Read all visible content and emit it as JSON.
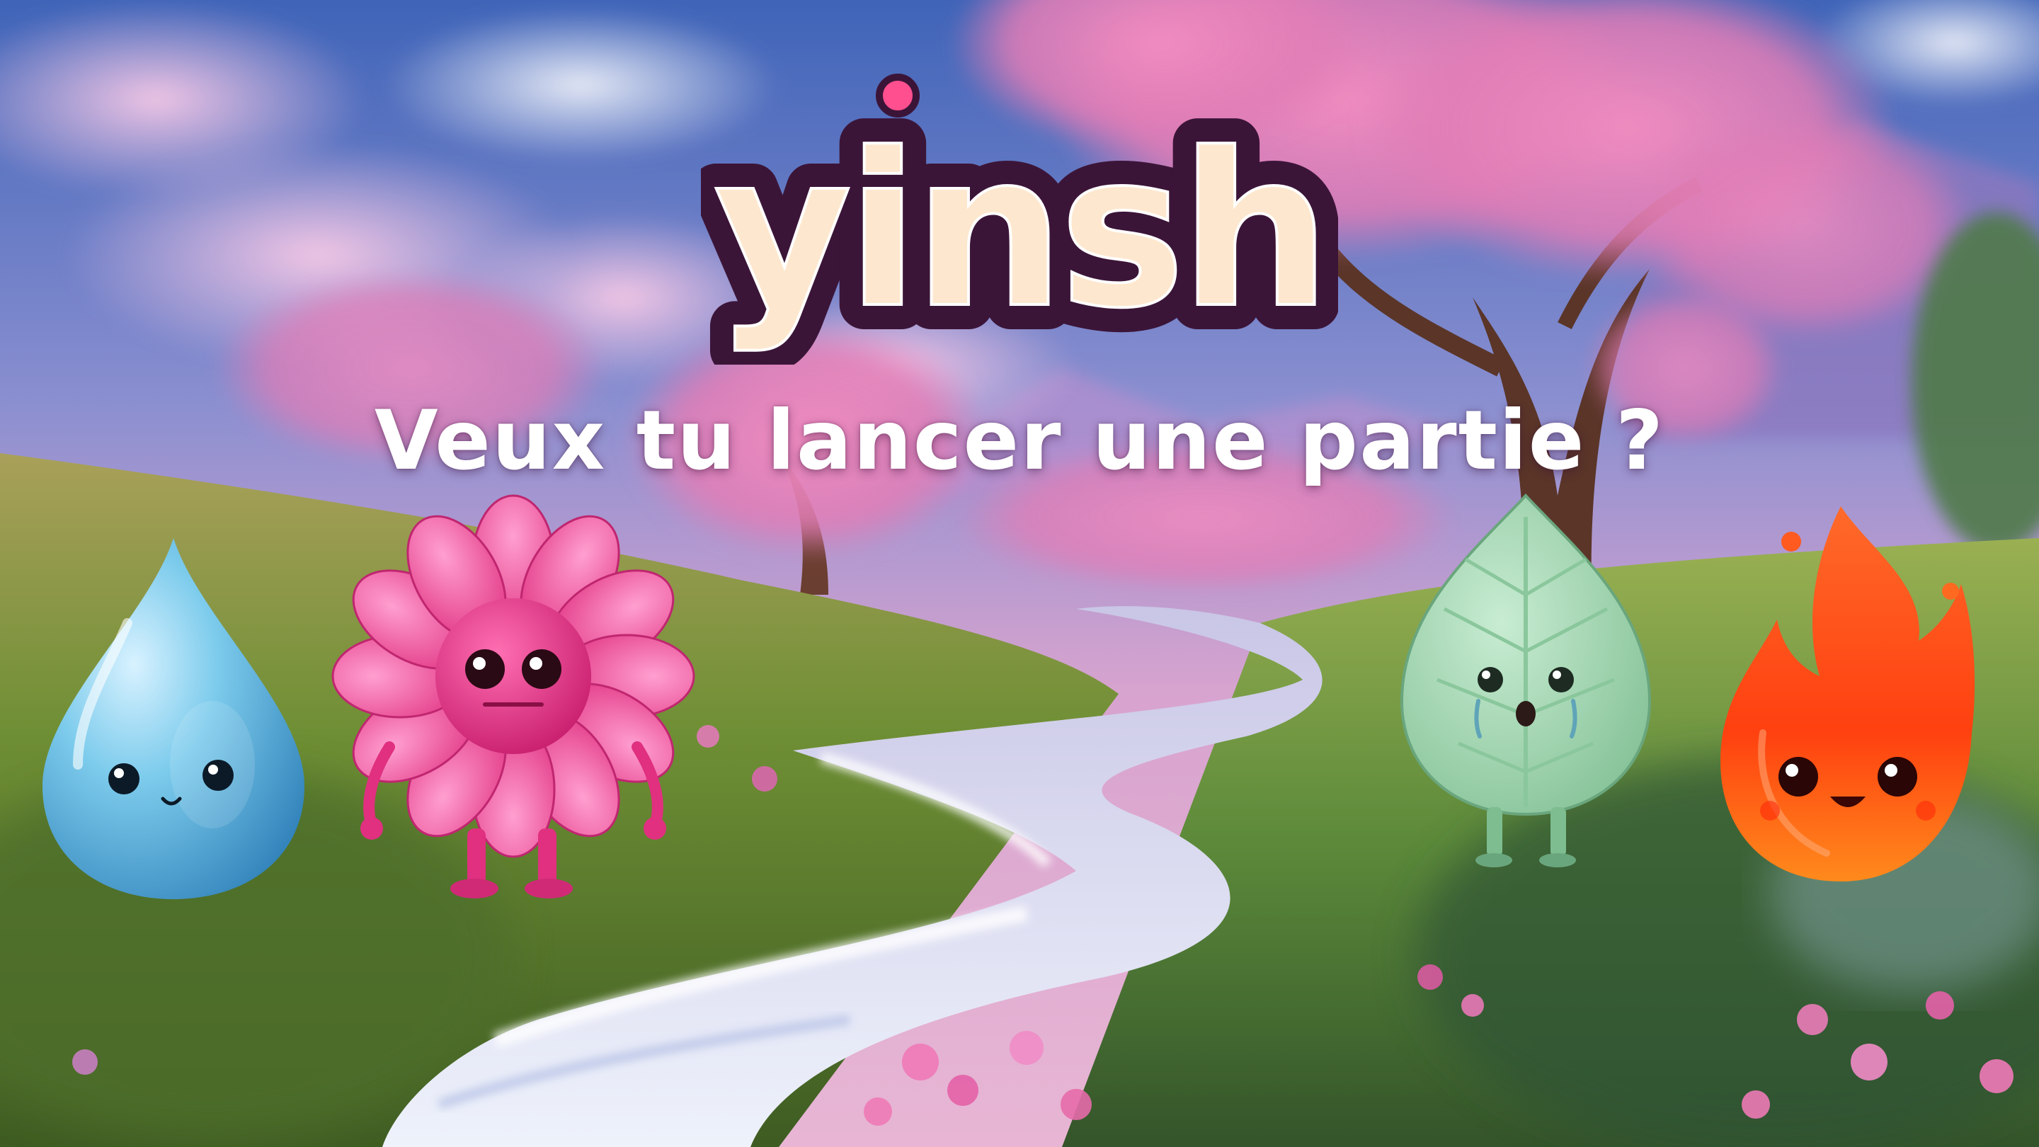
{
  "game": {
    "logo_text": "yinsh",
    "prompt": "Veux tu lancer une partie ?"
  },
  "characters": [
    {
      "name": "water-drop",
      "element": "water",
      "color": "#6ec4e8"
    },
    {
      "name": "flower",
      "element": "flower",
      "color": "#ec3f9a"
    },
    {
      "name": "leaf",
      "element": "plant",
      "color": "#8fd0a4"
    },
    {
      "name": "fire",
      "element": "fire",
      "color": "#ff4a1c"
    }
  ],
  "palette": {
    "logo_fill": "#fde8cf",
    "logo_outline": "#3b1538",
    "logo_dot": "#ff4f8e",
    "sky_top": "#4f78c8",
    "blossom_pink": "#ee9cc4",
    "grass_green": "#6c9a3c",
    "river": "#dfe8f6"
  }
}
